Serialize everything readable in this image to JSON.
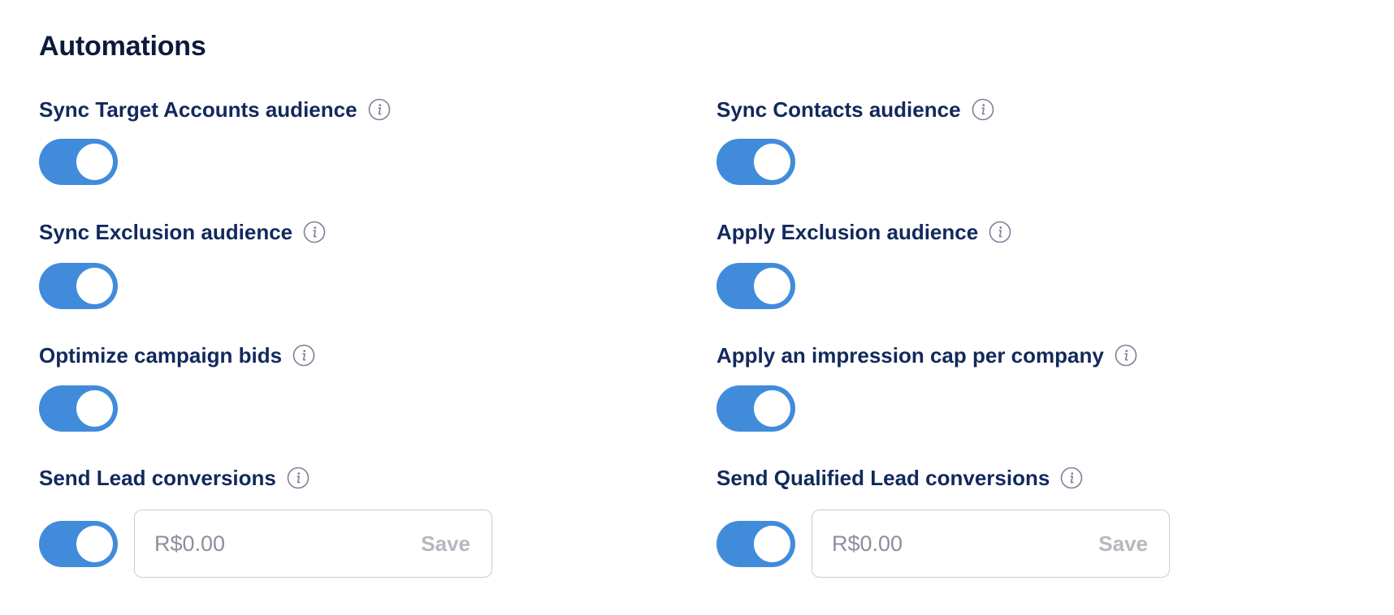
{
  "page": {
    "title": "Automations"
  },
  "settings": {
    "sync_target_accounts": {
      "label": "Sync Target Accounts audience",
      "enabled": true
    },
    "sync_contacts": {
      "label": "Sync Contacts audience",
      "enabled": true
    },
    "sync_exclusion": {
      "label": "Sync Exclusion audience",
      "enabled": true
    },
    "apply_exclusion": {
      "label": "Apply Exclusion audience",
      "enabled": true
    },
    "optimize_bids": {
      "label": "Optimize campaign bids",
      "enabled": true
    },
    "impression_cap": {
      "label": "Apply an impression cap per company",
      "enabled": true
    },
    "send_lead": {
      "label": "Send Lead conversions",
      "enabled": true,
      "value_placeholder": "R$0.00",
      "save_label": "Save"
    },
    "send_qualified_lead": {
      "label": "Send Qualified Lead conversions",
      "enabled": true,
      "value_placeholder": "R$0.00",
      "save_label": "Save"
    }
  },
  "colors": {
    "toggle_on": "#418bdb",
    "label": "#12295c",
    "title": "#0c1a3d",
    "info_icon": "#7b8296",
    "save_disabled": "#b4b8bf"
  },
  "icons": {
    "info": "info-icon"
  }
}
